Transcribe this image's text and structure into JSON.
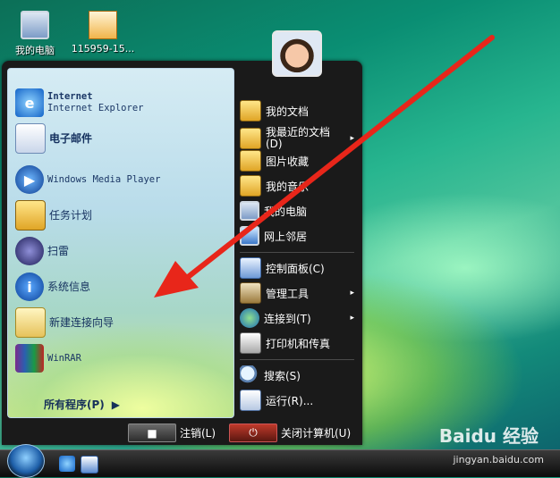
{
  "desktop": {
    "icons": [
      {
        "label": "我的电脑",
        "icon": "computer-icon"
      },
      {
        "label": "115959-15...",
        "icon": "image-file-icon"
      }
    ]
  },
  "start_menu": {
    "pinned": [
      {
        "title": "Internet",
        "subtitle": "Internet Explorer",
        "icon": "internet-explorer-icon"
      },
      {
        "title": "电子邮件",
        "icon": "email-icon"
      }
    ],
    "recent": [
      {
        "label": "Windows Media Player",
        "icon": "media-player-icon"
      },
      {
        "label": "任务计划",
        "icon": "task-scheduler-icon"
      },
      {
        "label": "扫雷",
        "icon": "minesweeper-icon"
      },
      {
        "label": "系统信息",
        "icon": "system-info-icon"
      },
      {
        "label": "新建连接向导",
        "icon": "connection-wizard-icon"
      },
      {
        "label": "WinRAR",
        "icon": "winrar-icon"
      }
    ],
    "all_programs": "所有程序(P)",
    "right": [
      {
        "label": "我的文档",
        "icon": "documents-folder-icon"
      },
      {
        "label": "我最近的文档",
        "sub": "(D)",
        "icon": "recent-docs-folder-icon",
        "arrow": "▸"
      },
      {
        "label": "图片收藏",
        "icon": "pictures-folder-icon"
      },
      {
        "label": "我的音乐",
        "icon": "music-folder-icon"
      },
      {
        "label": "我的电脑",
        "icon": "computer-icon"
      },
      {
        "label": "网上邻居",
        "icon": "network-icon"
      },
      {
        "label": "控制面板(C)",
        "icon": "control-panel-icon"
      },
      {
        "label": "管理工具",
        "icon": "admin-tools-icon",
        "arrow": "▸"
      },
      {
        "label": "连接到(T)",
        "icon": "connect-to-icon",
        "arrow": "▸"
      },
      {
        "label": "打印机和传真",
        "icon": "printer-icon"
      },
      {
        "label": "搜索(S)",
        "icon": "search-icon"
      },
      {
        "label": "运行(R)...",
        "icon": "run-icon"
      }
    ],
    "logoff_label": "注销(L)",
    "shutdown_label": "关闭计算机(U)"
  },
  "watermark": {
    "brand": "Baidu 经验",
    "url": "jingyan.baidu.com"
  },
  "colors": {
    "accent_red": "#e8261a"
  }
}
